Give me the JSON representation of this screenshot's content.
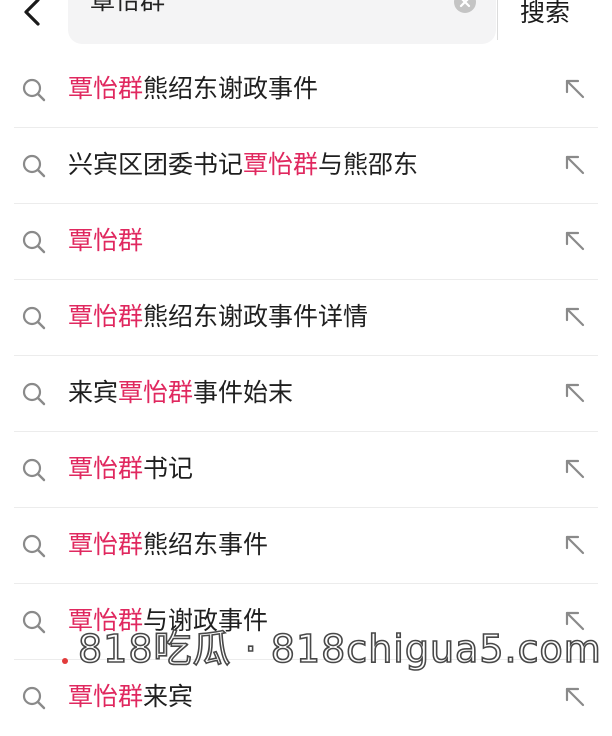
{
  "header": {
    "back_icon": "chevron-left-icon",
    "search_value": "覃怡群",
    "clear_icon": "clear-circle-icon",
    "search_button_label": "搜索"
  },
  "colors": {
    "highlight": "#e0285f",
    "text": "#1f1f1f",
    "icon": "#8a8a8a",
    "search_bg": "#f4f4f5",
    "divider": "#ececec"
  },
  "suggestions": [
    {
      "before": "",
      "highlight": "覃怡群",
      "after": "熊绍东谢政事件",
      "icon": "search-icon",
      "action_icon": "fill-query-arrow-icon"
    },
    {
      "before": "兴宾区团委书记",
      "highlight": "覃怡群",
      "after": "与熊邵东",
      "icon": "search-icon",
      "action_icon": "fill-query-arrow-icon"
    },
    {
      "before": "",
      "highlight": "覃怡群",
      "after": "",
      "icon": "search-icon",
      "action_icon": "fill-query-arrow-icon"
    },
    {
      "before": "",
      "highlight": "覃怡群",
      "after": "熊绍东谢政事件详情",
      "icon": "search-icon",
      "action_icon": "fill-query-arrow-icon"
    },
    {
      "before": "来宾",
      "highlight": "覃怡群",
      "after": "事件始末",
      "icon": "search-icon",
      "action_icon": "fill-query-arrow-icon"
    },
    {
      "before": "",
      "highlight": "覃怡群",
      "after": "书记",
      "icon": "search-icon",
      "action_icon": "fill-query-arrow-icon"
    },
    {
      "before": "",
      "highlight": "覃怡群",
      "after": "熊绍东事件",
      "icon": "search-icon",
      "action_icon": "fill-query-arrow-icon"
    },
    {
      "before": "",
      "highlight": "覃怡群",
      "after": "与谢政事件",
      "icon": "search-icon",
      "action_icon": "fill-query-arrow-icon"
    },
    {
      "before": "",
      "highlight": "覃怡群",
      "after": "来宾",
      "icon": "search-icon",
      "action_icon": "fill-query-arrow-icon"
    }
  ],
  "watermark": {
    "text": "818吃瓜 · 818chigua5.com"
  }
}
